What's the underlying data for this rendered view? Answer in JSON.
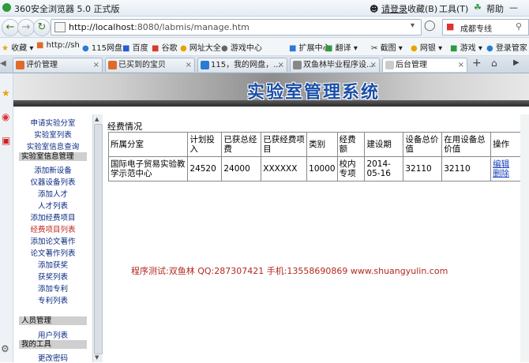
{
  "browser": {
    "title": "360安全浏览器 5.0 正式版",
    "login": "请登录",
    "favorites_menu": "收藏(B)",
    "tools_menu": "工具(T)",
    "help_menu": "帮助",
    "url_host": "http://localhost",
    "url_path": ":8080/labmis/manage.htm",
    "search_placeholder": "成都专线"
  },
  "bookmarks": {
    "favorites": "收藏",
    "items": [
      "http://sh",
      "115网盘",
      "百度",
      "谷歌",
      "网址大全",
      "游戏中心"
    ],
    "right_items": [
      "扩展中心",
      "翻译",
      "截图",
      "网银",
      "游戏",
      "登录管家"
    ]
  },
  "tabs": [
    {
      "label": "评价管理",
      "active": false
    },
    {
      "label": "已买到的宝贝",
      "active": false
    },
    {
      "label": "115，我的网盘，...",
      "active": false
    },
    {
      "label": "双鱼林毕业程序设...",
      "active": false
    },
    {
      "label": "后台管理",
      "active": true
    }
  ],
  "banner": {
    "title": "实验室管理系统"
  },
  "menu": {
    "items": [
      {
        "label": "申请实验分室",
        "type": "item"
      },
      {
        "label": "实验室列表",
        "type": "item"
      },
      {
        "label": "实验室信息查询",
        "type": "item"
      },
      {
        "label": "实验室信息管理",
        "type": "header"
      },
      {
        "label": "添加新设备",
        "type": "item"
      },
      {
        "label": "仪器设备列表",
        "type": "item"
      },
      {
        "label": "添加人才",
        "type": "item"
      },
      {
        "label": "人才列表",
        "type": "item"
      },
      {
        "label": "添加经费项目",
        "type": "item"
      },
      {
        "label": "经费项目列表",
        "type": "active"
      },
      {
        "label": "添加论文著作",
        "type": "item"
      },
      {
        "label": "论文著作列表",
        "type": "item"
      },
      {
        "label": "添加获奖",
        "type": "item"
      },
      {
        "label": "获奖列表",
        "type": "item"
      },
      {
        "label": "添加专利",
        "type": "item"
      },
      {
        "label": "专利列表",
        "type": "item"
      },
      {
        "label": "人员管理",
        "type": "header"
      },
      {
        "label": "用户列表",
        "type": "item"
      },
      {
        "label": "我的工具",
        "type": "header"
      },
      {
        "label": "更改密码",
        "type": "item"
      }
    ]
  },
  "section_title": "经费情况",
  "table": {
    "headers": [
      "所属分室",
      "计划投入",
      "已获总经费",
      "已获经费项目",
      "类别",
      "经费额",
      "建设期",
      "设备总价值",
      "在用设备总价值",
      "操作"
    ],
    "rows": [
      [
        "国际电子贸易实验教学示范中心",
        "24520",
        "24000",
        "XXXXXX",
        "10000",
        "校内专项",
        "2014-05-16",
        "32110",
        "32110"
      ]
    ],
    "actions": {
      "edit": "编辑",
      "delete": "删除"
    }
  },
  "credit": "程序测试:双鱼林 QQ:287307421 手机:13558690869 www.shuangyulin.com"
}
